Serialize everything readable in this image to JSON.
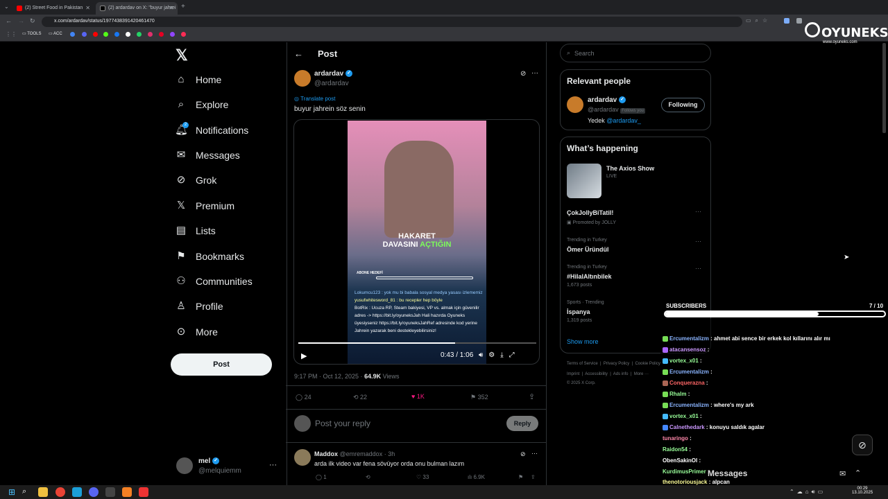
{
  "browser": {
    "tabs": [
      {
        "label": "(2) Street Food in Pakistan"
      },
      {
        "label": "(2) ardardav on X: \"buyur jahrei"
      }
    ],
    "url": "x.com/ardardav/status/1977438391420461470",
    "bookmarks": [
      "TOOLS",
      "ACC"
    ]
  },
  "overlay": {
    "brand": "OYUNEKS",
    "site": "www.oyuneks.com",
    "subscribers_label": "SUBSCRIBERS",
    "subscribers_count": "7 / 10",
    "subscribers_progress": 0.7
  },
  "nav": {
    "logo": "𝕏",
    "items": [
      "Home",
      "Explore",
      "Notifications",
      "Messages",
      "Grok",
      "Premium",
      "Lists",
      "Bookmarks",
      "Communities",
      "Profile",
      "More"
    ],
    "notif_count": "2",
    "post_button": "Post"
  },
  "account": {
    "name": "mel",
    "handle": "@melquiemm"
  },
  "header": {
    "title": "Post"
  },
  "post": {
    "author": "ardardav",
    "handle": "@ardardav",
    "translate": "Translate post",
    "text": "buyur jahrein söz senin",
    "video": {
      "caption_line1": "HAKARET",
      "caption_line2": "DAVASINI",
      "caption_hl": "AÇTIĞIN",
      "time": "0:43 / 1:06",
      "goal": "ABONE HEDEFİ",
      "chat": [
        "Lokumcu123 : yok mu bi babala sosyal medya yasası izlememiz",
        "yusufwhitesword_81 : bu recepler hep böyle",
        "BotRix : Ucuza RP, Steam bakiyesi, VP vs. almak için güvenilir adres -> https://bit.ly/oyuneksJah Hali hazırda Oyuneks üyesiyseniz https://bit.ly/oyuneksJahRef adresinde kod yerine Jahrein yazarak beni destekleyebilirsiniz!"
      ]
    },
    "meta_time": "9:17 PM · Oct 12, 2025 · ",
    "views": "64.9K",
    "views_label": " Views",
    "replies": "24",
    "reposts": "22",
    "likes": "1K",
    "bookmarks": "352",
    "reply_placeholder": "Post your reply",
    "reply_button": "Reply"
  },
  "reply": {
    "author": "Maddox",
    "handle": "@emremaddox · 3h",
    "text": "arda ilk video var fena  sövüyor orda onu bulman lazım",
    "replies": "1",
    "likes": "33",
    "views": "6.9K"
  },
  "sidebar": {
    "search_placeholder": "Search",
    "relevant_title": "Relevant people",
    "rp_name": "ardardav",
    "rp_handle": "@ardardav",
    "rp_follows": "Follows you",
    "rp_button": "Following",
    "rp_bio": "Yedek ",
    "rp_bio_link": "@ardardav_",
    "happening_title": "What’s happening",
    "axios_title": "The Axios Show",
    "axios_live": "LIVE",
    "trends": [
      {
        "context": "",
        "name": "ÇokJollyBiTatil!",
        "sub": "Promoted by JOLLY"
      },
      {
        "context": "Trending in Turkey",
        "name": "Ömer Üründül",
        "sub": ""
      },
      {
        "context": "Trending in Turkey",
        "name": "#HilalAltınbilek",
        "sub": "1,673 posts"
      },
      {
        "context": "Sports · Trending",
        "name": "İspanya",
        "sub": "1,319 posts"
      }
    ],
    "show_more": "Show more",
    "footer1": "Terms of Service  |  Privacy Policy  |  Cookie Policy",
    "footer2": "Imprint  |  Accessibility  |  Ads info  |  More ···",
    "footer3": "© 2025 X Corp."
  },
  "chat": [
    {
      "user": "Ercumentalizm",
      "msg": ": ahmet abi sence bir erkek kol kıllarını alır mı"
    },
    {
      "user": "atacansensoz",
      "msg": ":"
    },
    {
      "user": "vortex_x01",
      "msg": ":"
    },
    {
      "user": "Ercumentalizm",
      "msg": ":"
    },
    {
      "user": "Conquerazna",
      "msg": ":"
    },
    {
      "user": "Rhalm",
      "msg": ":"
    },
    {
      "user": "Ercumentalizm",
      "msg": ": where's my ark"
    },
    {
      "user": "vortex_x01",
      "msg": ":"
    },
    {
      "user": "Calnethedark",
      "msg": ": konuyu saldık agalar"
    },
    {
      "user": "tunaringo",
      "msg": ":"
    },
    {
      "user": "Raidon54",
      "msg": ":"
    },
    {
      "user": "ObenSakinOl",
      "msg": ":"
    },
    {
      "user": "KurdimusPrimer",
      "msg": ":"
    },
    {
      "user": "thenotoriousjack",
      "msg": ": alpcan"
    }
  ],
  "messages_drawer": "Messages",
  "clock": {
    "time": "00:29",
    "date": "13.10.2025"
  },
  "colors": {
    "accent": "#1d9bf0",
    "like": "#f91880",
    "bg": "#000000",
    "border": "#2f3336"
  }
}
